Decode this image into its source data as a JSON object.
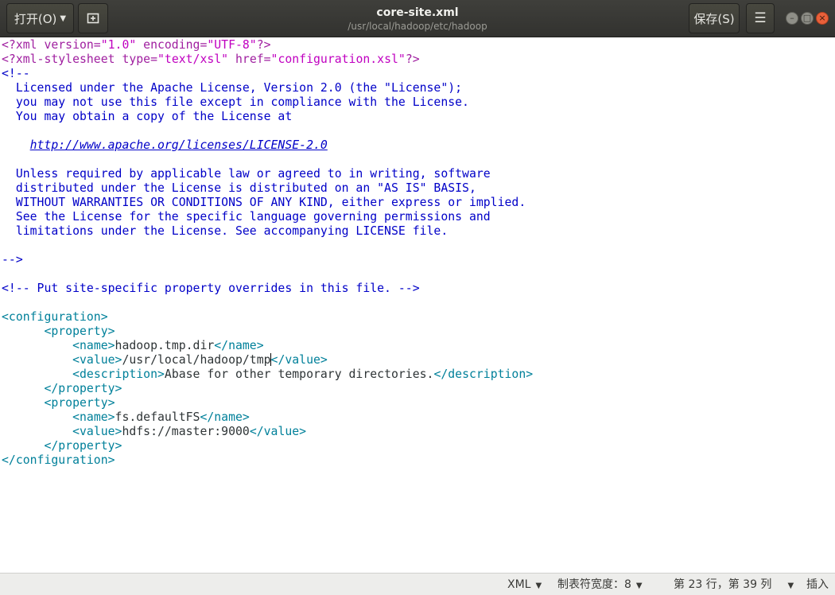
{
  "header": {
    "open_label": "打开(O)",
    "title": "core-site.xml",
    "subtitle": "/usr/local/hadoop/etc/hadoop",
    "save_label": "保存(S)"
  },
  "editor": {
    "lines": {
      "l1": {
        "a": "<?xml version=",
        "b": "\"1.0\"",
        "c": " encoding=",
        "d": "\"UTF-8\"",
        "e": "?>"
      },
      "l2": {
        "a": "<?xml-stylesheet ",
        "b": "type=",
        "c": "\"text/xsl\"",
        "d": " href=",
        "e": "\"configuration.xsl\"",
        "f": "?>"
      },
      "l3": "<!--",
      "l4": "  Licensed under the Apache License, Version 2.0 (the \"License\");",
      "l5": "  you may not use this file except in compliance with the License.",
      "l6": "  You may obtain a copy of the License at",
      "l8": "http://www.apache.org/licenses/LICENSE-2.0",
      "l10": "  Unless required by applicable law or agreed to in writing, software",
      "l11": "  distributed under the License is distributed on an \"AS IS\" BASIS,",
      "l12": "  WITHOUT WARRANTIES OR CONDITIONS OF ANY KIND, either express or implied.",
      "l13": "  See the License for the specific language governing permissions and",
      "l14": "  limitations under the License. See accompanying LICENSE file.",
      "l16": "-->",
      "l18": "<!-- Put site-specific property overrides in this file. -->",
      "l20": "<configuration>",
      "l21": "<property>",
      "l22": {
        "open": "<name>",
        "text": "hadoop.tmp.dir",
        "close": "</name>"
      },
      "l23": {
        "open": "<value>",
        "text": "/usr/local/hadoop/tmp",
        "close": "</value>"
      },
      "l24": {
        "open": "<description>",
        "text": "Abase for other temporary directories.",
        "close": "</description>"
      },
      "l25": "</property>",
      "l26": "<property>",
      "l27": {
        "open": "<name>",
        "text": "fs.defaultFS",
        "close": "</name>"
      },
      "l28": {
        "open": "<value>",
        "text": "hdfs://master:9000",
        "close": "</value>"
      },
      "l29": "</property>",
      "l30": "</configuration>"
    }
  },
  "statusbar": {
    "language": "XML",
    "tab_width": "制表符宽度：8",
    "position": "第 23 行，第 39 列",
    "mode": "插入"
  },
  "colors": {
    "header_bg": "#3c3c38",
    "comment": "#0000c8",
    "tag": "#00809a",
    "decl": "#a020a0",
    "string": "#c000c0"
  }
}
